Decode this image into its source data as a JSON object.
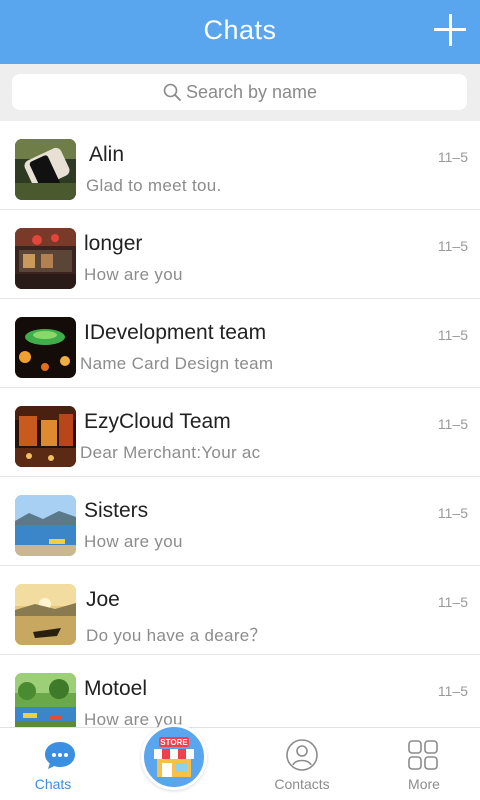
{
  "header": {
    "title": "Chats",
    "add_icon": "plus-icon"
  },
  "search": {
    "placeholder": "Search by name",
    "icon": "search-icon"
  },
  "chats": [
    {
      "name": "Alin",
      "message": "Glad to meet tou.",
      "time": "11–5"
    },
    {
      "name": "longer",
      "message": "How are you",
      "time": "11–5"
    },
    {
      "name": "IDevelopment team",
      "message": "Name Card Design team",
      "time": "11–5"
    },
    {
      "name": "EzyCloud Team",
      "message": "Dear Merchant:Your ac",
      "time": "11–5"
    },
    {
      "name": "Sisters",
      "message": "How are you",
      "time": "11–5"
    },
    {
      "name": "Joe",
      "message": "Do you have a deare？",
      "time": "11–5"
    },
    {
      "name": "Motoel",
      "message": "How are you",
      "time": "11–5"
    }
  ],
  "tabbar": {
    "chats": "Chats",
    "store_badge": "STORE",
    "contacts": "Contacts",
    "more": "More"
  },
  "colors": {
    "accent": "#5aa6ee",
    "active_tab": "#3a8fe0"
  }
}
